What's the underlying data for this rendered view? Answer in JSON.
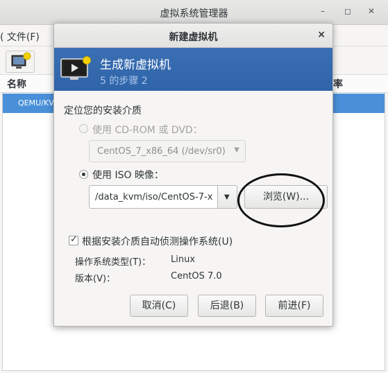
{
  "main_window": {
    "title": "虚拟系统管理器",
    "menu": {
      "file": "( 文件(F)"
    },
    "table": {
      "columns": [
        "名称",
        "率"
      ],
      "rows": [
        {
          "name": "QEMU/KV",
          "selected": true
        }
      ]
    },
    "window_buttons": {
      "minimize": "–",
      "maximize": "◻",
      "close": "✕"
    }
  },
  "dialog": {
    "title": "新建虚拟机",
    "close_label": "×",
    "banner": {
      "title": "生成新虚拟机",
      "step": "5 的步骤 2"
    },
    "section_label": "定位您的安装介质",
    "cdrom": {
      "label": "使用  CD-ROM 或  DVD：",
      "selected": false,
      "enabled": false,
      "device": "CentOS_7_x86_64 (/dev/sr0)"
    },
    "iso": {
      "label": "使用  ISO 映像：",
      "selected": true,
      "path": "/data_kvm/iso/CentOS-7-x",
      "browse_label": "浏览(W)..."
    },
    "autodetect": {
      "label": "根据安装介质自动侦测操作系统(U)",
      "checked": true
    },
    "os_type": {
      "label": "操作系统类型(T)：",
      "value": "Linux"
    },
    "version": {
      "label": "版本(V)：",
      "value": "CentOS 7.0"
    },
    "buttons": {
      "cancel": "取消(C)",
      "back": "后退(B)",
      "forward": "前进(F)"
    }
  },
  "colors": {
    "banner": "#3465a4",
    "selection": "#4a90d9",
    "annotation_circle": "#111111"
  }
}
